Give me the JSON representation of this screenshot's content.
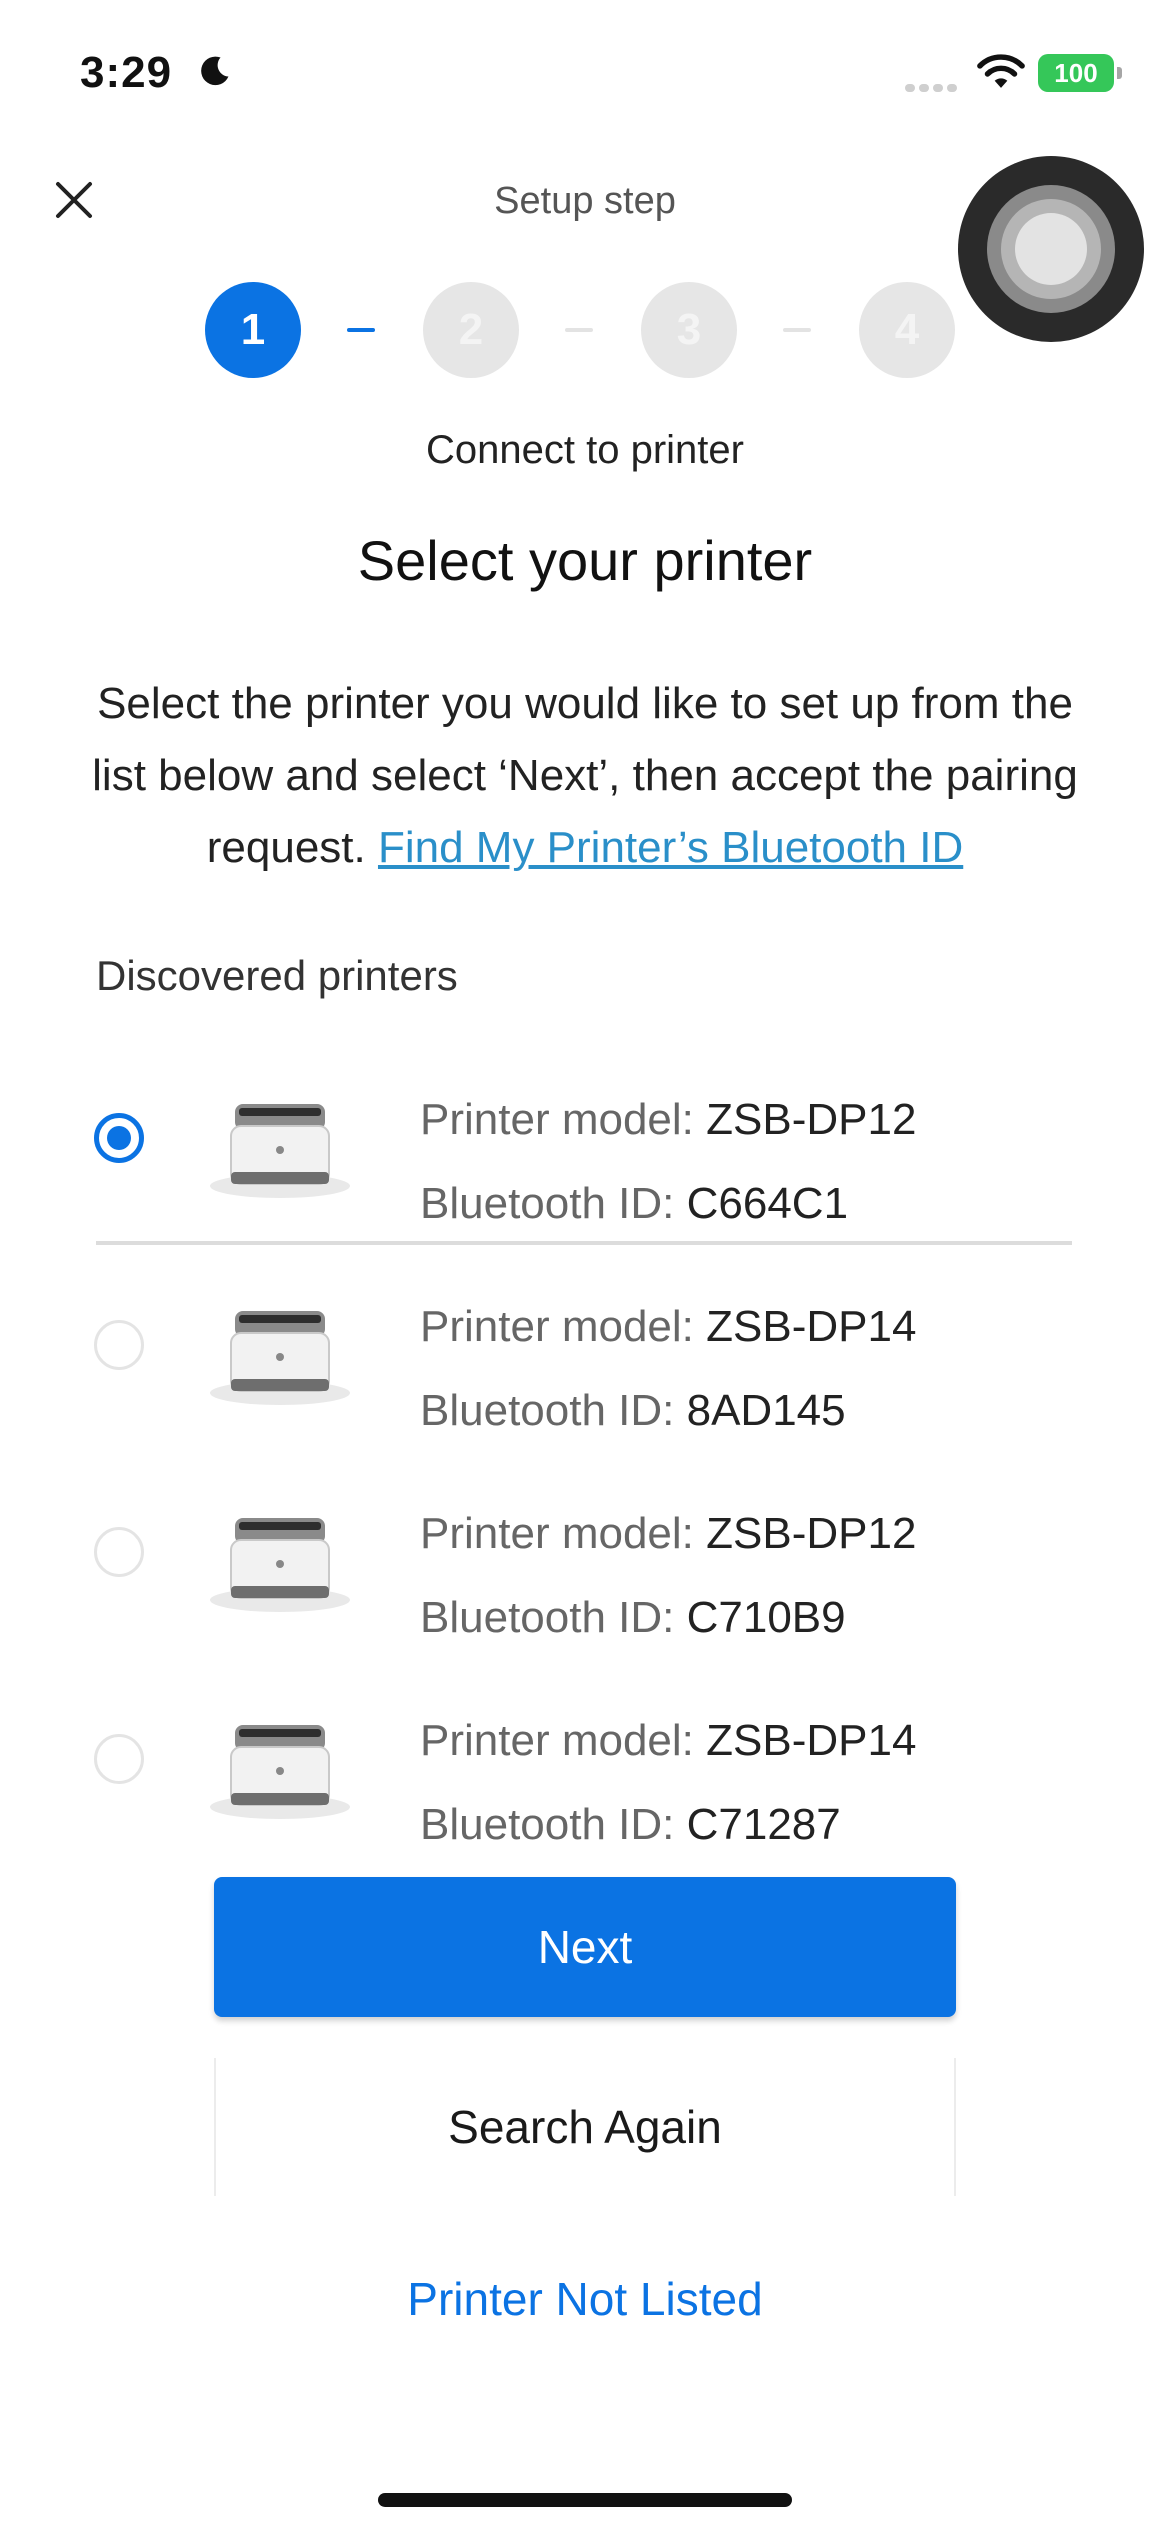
{
  "status_bar": {
    "time": "3:29",
    "focus_icon": "moon-icon",
    "wifi_icon": "wifi-icon",
    "battery_level": "100",
    "battery_color": "#35c759"
  },
  "header": {
    "close_icon": "close-icon",
    "setup_step_label": "Setup step",
    "steps": [
      "1",
      "2",
      "3",
      "4"
    ],
    "active_step": 1,
    "step_subtitle": "Connect to printer"
  },
  "main": {
    "heading": "Select your printer",
    "description": "Select the printer you would like to set up from the list below and select ‘Next’, then accept the pairing request.",
    "description_link": "Find My Printer’s Bluetooth ID",
    "section_label": "Discovered printers",
    "model_label": "Printer model:",
    "bt_label": "Bluetooth ID:",
    "printers": [
      {
        "model": "ZSB-DP12",
        "bluetooth_id": "C664C1",
        "selected": true
      },
      {
        "model": "ZSB-DP14",
        "bluetooth_id": "8AD145",
        "selected": false
      },
      {
        "model": "ZSB-DP12",
        "bluetooth_id": "C710B9",
        "selected": false
      },
      {
        "model": "ZSB-DP14",
        "bluetooth_id": "C71287",
        "selected": false
      }
    ]
  },
  "actions": {
    "next_label": "Next",
    "search_again_label": "Search Again",
    "not_listed_label": "Printer Not Listed"
  },
  "colors": {
    "accent": "#0b73e3",
    "link": "#2a8fc9"
  }
}
